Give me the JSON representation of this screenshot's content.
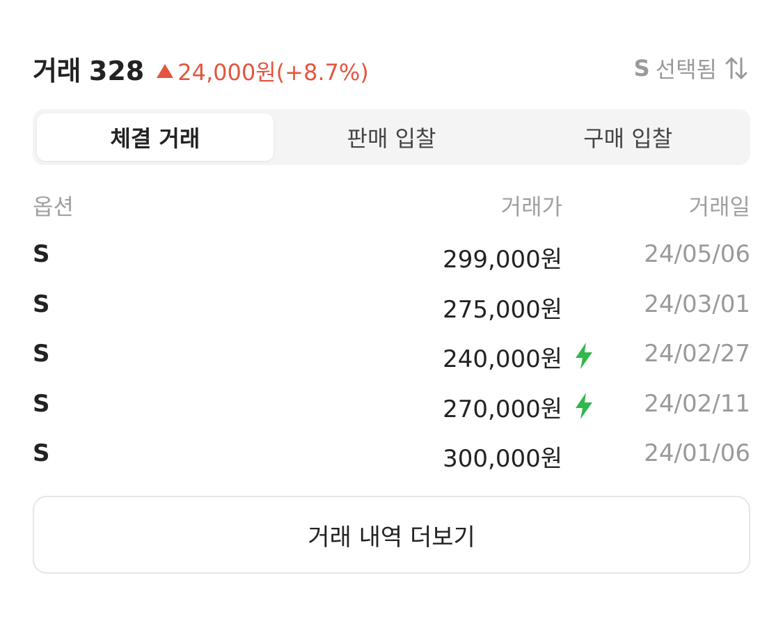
{
  "header": {
    "title": "거래",
    "count": "328",
    "change_icon": "triangle-up-icon",
    "change_text": "24,000원(+8.7%)",
    "size_selected": "S",
    "size_selected_suffix": "선택됨",
    "sort_icon": "sort-arrows-icon"
  },
  "tabs": [
    {
      "label": "체결 거래",
      "active": true
    },
    {
      "label": "판매 입찰",
      "active": false
    },
    {
      "label": "구매 입찰",
      "active": false
    }
  ],
  "table": {
    "columns": [
      "옵션",
      "거래가",
      "거래일"
    ],
    "rows": [
      {
        "option": "S",
        "price": "299,000원",
        "fast": false,
        "date": "24/05/06"
      },
      {
        "option": "S",
        "price": "275,000원",
        "fast": false,
        "date": "24/03/01"
      },
      {
        "option": "S",
        "price": "240,000원",
        "fast": true,
        "date": "24/02/27"
      },
      {
        "option": "S",
        "price": "270,000원",
        "fast": true,
        "date": "24/02/11"
      },
      {
        "option": "S",
        "price": "300,000원",
        "fast": false,
        "date": "24/01/06"
      }
    ]
  },
  "more_button": {
    "label": "거래 내역 더보기"
  },
  "colors": {
    "accent_red": "#e4553e",
    "bolt_green": "#31b84b",
    "muted_gray": "#9a9a9a"
  }
}
